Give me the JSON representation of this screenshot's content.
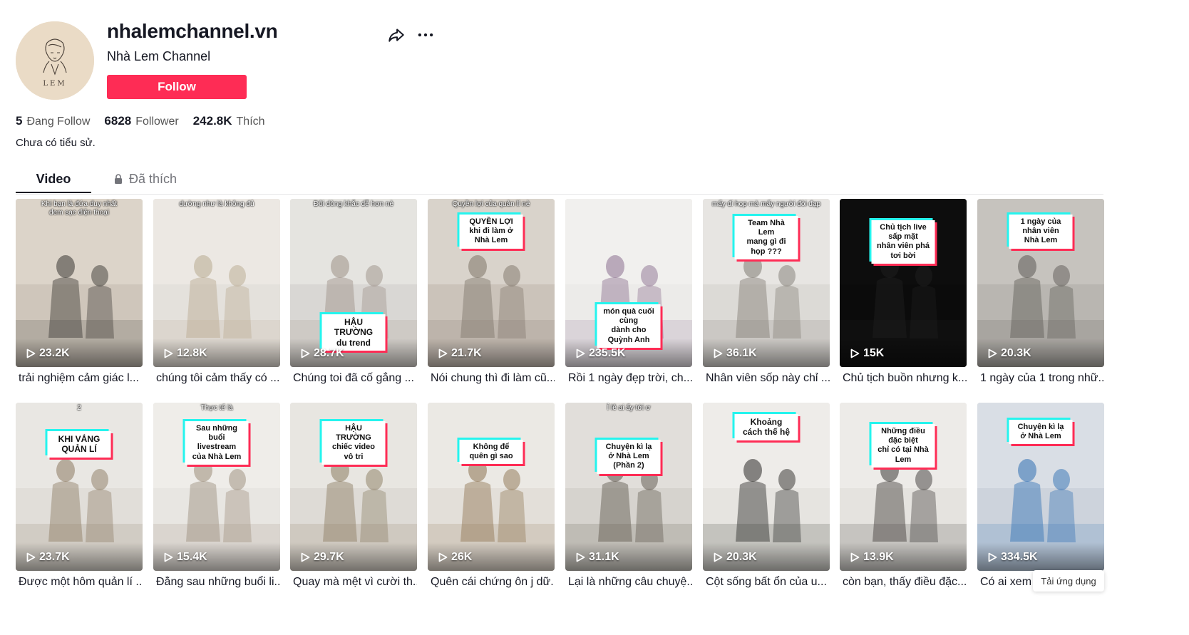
{
  "profile": {
    "username": "nhalemchannel.vn",
    "display_name": "Nhà Lem Channel",
    "avatar_text": "LEM",
    "follow_label": "Follow",
    "bio": "Chưa có tiểu sử."
  },
  "stats": {
    "following": {
      "value": "5",
      "label": "Đang Follow"
    },
    "followers": {
      "value": "6828",
      "label": "Follower"
    },
    "likes": {
      "value": "242.8K",
      "label": "Thích"
    }
  },
  "tabs": {
    "video": "Video",
    "liked": "Đã thích"
  },
  "colors": {
    "accent": "#fe2c55",
    "cyan": "#25f4ee",
    "text": "#161823"
  },
  "videos": [
    {
      "views": "23.2K",
      "title": "trải nghiệm cảm giác l...",
      "top_text": "Khi bạn là đứa duy nhất\nđem sạc điện thoại",
      "caption": ""
    },
    {
      "views": "12.8K",
      "title": "chúng tôi cảm thấy có ...",
      "top_text": "dường như là không đủ",
      "caption": ""
    },
    {
      "views": "28.7K",
      "title": "Chúng toi đã cố gắng ...",
      "top_text": "Đôi dòng khắc dễ hơn nè",
      "caption": "HẬU TRƯỜNG\ndu trend"
    },
    {
      "views": "21.7K",
      "title": "Nói chung thì đi làm cũ...",
      "top_text": "Quyền lợi của quản lí nè",
      "caption": "QUYỀN LỢI\nkhi đi làm ở Nhà Lem"
    },
    {
      "views": "235.5K",
      "title": "Rồi 1 ngày đẹp trời, ch...",
      "top_text": "",
      "caption": "món quà cuối cùng\ndành cho Quỳnh Anh"
    },
    {
      "views": "36.1K",
      "title": "Nhân viên sốp này chỉ ...",
      "top_text": "mấy đi họp mà mấy người đòi đạp",
      "caption": "Team Nhà Lem\nmang gì đi họp ???"
    },
    {
      "views": "15K",
      "title": "Chủ tịch buồn nhưng k...",
      "top_text": "",
      "caption": "Chủ tịch live sấp mặt\nnhân viên phá tơi bời"
    },
    {
      "views": "20.3K",
      "title": "1 ngày của 1 trong nhữ...",
      "top_text": "",
      "caption": "1 ngày của nhân viên\nNhà Lem"
    },
    {
      "views": "23.7K",
      "title": "Được một hôm quản lí ...",
      "top_text": "2",
      "caption": "KHI VẮNG QUẢN LÍ"
    },
    {
      "views": "15.4K",
      "title": "Đằng sau những buổi li...",
      "top_text": "Thực tế là",
      "caption": "Sau những buổi\nlivestream của Nhà Lem"
    },
    {
      "views": "29.7K",
      "title": "Quay mà mệt vì cười th...",
      "top_text": "",
      "caption": "HẬU TRƯỜNG\nchiếc video vô tri"
    },
    {
      "views": "26K",
      "title": "Quên cái chứng ôn j dữ...",
      "top_text": "",
      "caption": "Không để quên gì sao"
    },
    {
      "views": "31.1K",
      "title": "Lại là những câu chuyệ...",
      "top_text": "Ỉ lê ai ấy tới ơ",
      "caption": "Chuyện kì lạ ở Nhà Lem\n(Phần 2)"
    },
    {
      "views": "20.3K",
      "title": "Cột sống bất ổn của u...",
      "top_text": "",
      "caption": "Khoảng cách thế hệ"
    },
    {
      "views": "13.9K",
      "title": "còn bạn, thấy điều đặc...",
      "top_text": "",
      "caption": "Những điều đặc biệt\nchỉ có tại Nhà Lem"
    },
    {
      "views": "334.5K",
      "title": "Có ai xem l...",
      "top_text": "",
      "caption": "Chuyện kì lạ ở Nhà Lem"
    }
  ],
  "app_download_label": "Tải ứng dụng"
}
